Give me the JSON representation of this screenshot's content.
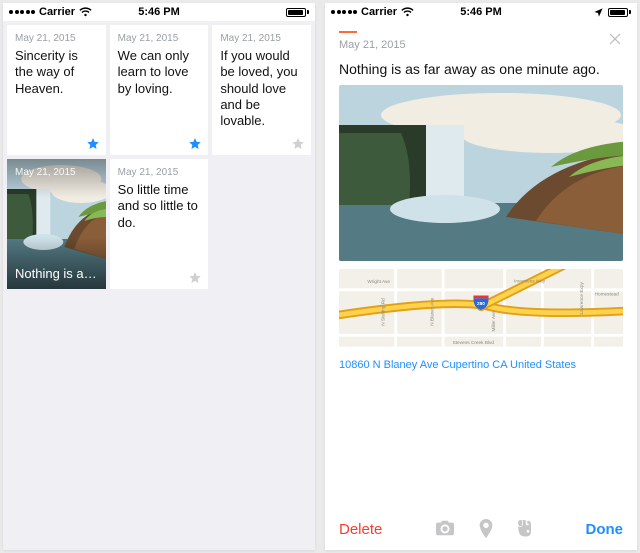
{
  "status": {
    "carrier": "Carrier",
    "time": "5:46 PM"
  },
  "grid": {
    "cards": [
      {
        "date": "May 21, 2015",
        "body": "Sincerity is the way of Heaven.",
        "starred": true
      },
      {
        "date": "May 21, 2015",
        "body": "We can only learn to love by loving.",
        "starred": true
      },
      {
        "date": "May 21, 2015",
        "body": "If you would be loved, you should love and be lovable.",
        "starred": false
      }
    ],
    "photoCard": {
      "date": "May 21, 2015",
      "caption": "Nothing is as…"
    },
    "card5": {
      "date": "May 21, 2015",
      "body": "So little time and so little to do.",
      "starred": false
    }
  },
  "detail": {
    "date": "May 21, 2015",
    "text": "Nothing is as far away as one minute ago.",
    "address": "10860 N Blaney Ave Cupertino CA United States",
    "map": {
      "shield": "280",
      "streets": [
        "Wright Ave",
        "N Stelling Rd",
        "N Blaney Ave",
        "Miller Ave",
        "Inverness Way",
        "Lawrence Expy",
        "Homestead",
        "Stevens Creek Blvd"
      ]
    },
    "toolbar": {
      "delete": "Delete",
      "done": "Done"
    }
  }
}
